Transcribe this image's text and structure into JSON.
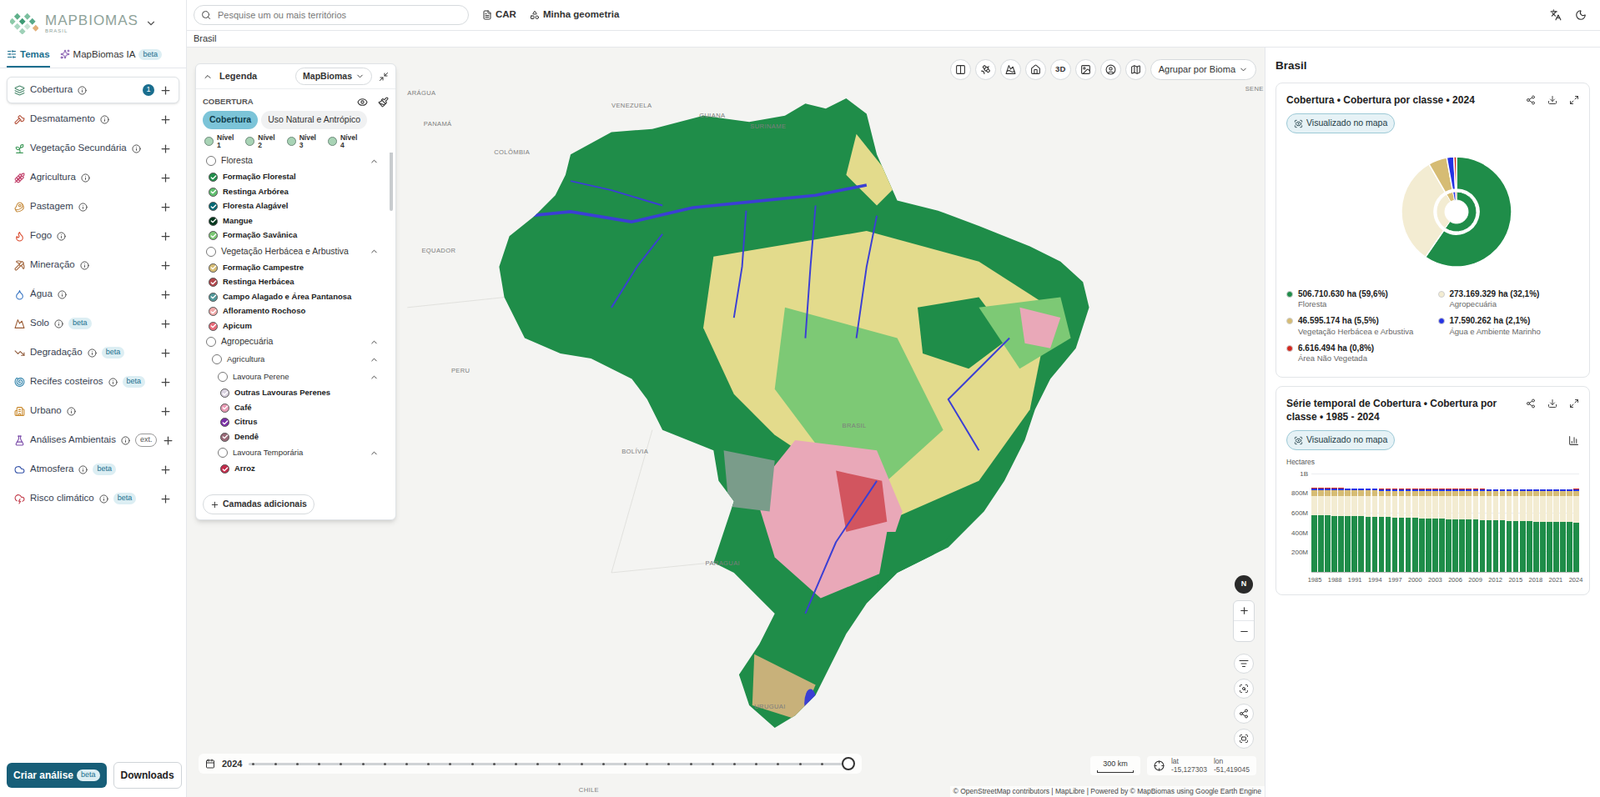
{
  "logo": {
    "name": "MAPBIOMAS",
    "subtitle": "BRASIL"
  },
  "sidebar_tabs": [
    {
      "label": "Temas",
      "selected": true
    },
    {
      "label": "MapBiomas IA",
      "badge": "beta",
      "selected": false
    }
  ],
  "themes": [
    {
      "label": "Cobertura",
      "count": "1",
      "selected": true,
      "color": "#4b8a6e"
    },
    {
      "label": "Desmatamento",
      "selected": false,
      "color": "#b5533c"
    },
    {
      "label": "Vegetação Secundária",
      "selected": false,
      "color": "#3f9a5a"
    },
    {
      "label": "Agricultura",
      "selected": false,
      "color": "#c2416b"
    },
    {
      "label": "Pastagem",
      "selected": false,
      "color": "#c58b3d"
    },
    {
      "label": "Fogo",
      "selected": false,
      "color": "#d9482b"
    },
    {
      "label": "Mineração",
      "selected": false,
      "color": "#a0633a"
    },
    {
      "label": "Água",
      "selected": false,
      "color": "#2f6fc0"
    },
    {
      "label": "Solo",
      "badge": "beta",
      "badge_kind": "filled",
      "selected": false,
      "color": "#9a5b34"
    },
    {
      "label": "Degradação",
      "badge": "beta",
      "badge_kind": "filled",
      "selected": false,
      "color": "#8f5a3a"
    },
    {
      "label": "Recifes costeiros",
      "badge": "beta",
      "badge_kind": "filled",
      "selected": false,
      "color": "#2a7fa8"
    },
    {
      "label": "Urbano",
      "selected": false,
      "color": "#c98a2e"
    },
    {
      "label": "Análises Ambientais",
      "badge": "ext.",
      "badge_kind": "outline",
      "selected": false,
      "color": "#7a4aa8"
    },
    {
      "label": "Atmosfera",
      "badge": "beta",
      "badge_kind": "filled",
      "selected": false,
      "color": "#3553a8"
    },
    {
      "label": "Risco climático",
      "badge": "beta",
      "badge_kind": "filled",
      "selected": false,
      "color": "#c23b4a"
    }
  ],
  "sidebar_buttons": {
    "primary": {
      "label": "Criar análise",
      "badge": "beta"
    },
    "secondary": "Downloads"
  },
  "search": {
    "placeholder": "Pesquise um ou mais territórios"
  },
  "top_links": [
    "CAR",
    "Minha geometria"
  ],
  "breadcrumb": "Brasil",
  "legend": {
    "title": "Legenda",
    "expanded": true,
    "source": "MapBiomas",
    "section": "COBERTURA",
    "modes": [
      {
        "label": "Cobertura",
        "selected": true
      },
      {
        "label": "Uso Natural e Antrópico",
        "selected": false
      }
    ],
    "levels": [
      {
        "label": "Nível",
        "number": "1",
        "selected": false
      },
      {
        "label": "Nível",
        "number": "2",
        "selected": false
      },
      {
        "label": "Nível",
        "number": "3",
        "selected": false
      },
      {
        "label": "Nível",
        "number": "4",
        "selected": false
      }
    ],
    "items": [
      {
        "kind": "group",
        "label": "Floresta",
        "depth": 0,
        "expanded": true,
        "checked": false
      },
      {
        "kind": "class",
        "label": "Formação Florestal",
        "depth": 1,
        "checked": true,
        "color": "#1f8d49"
      },
      {
        "kind": "class",
        "label": "Restinga Arbórea",
        "depth": 1,
        "checked": true,
        "color": "#5fbf6e"
      },
      {
        "kind": "class",
        "label": "Floresta Alagável",
        "depth": 1,
        "checked": true,
        "color": "#026975"
      },
      {
        "kind": "class",
        "label": "Mangue",
        "depth": 1,
        "checked": true,
        "color": "#04381d"
      },
      {
        "kind": "class",
        "label": "Formação Savânica",
        "depth": 1,
        "checked": true,
        "color": "#7dc975"
      },
      {
        "kind": "group",
        "label": "Vegetação Herbácea e Arbustiva",
        "depth": 0,
        "expanded": true,
        "checked": false
      },
      {
        "kind": "class",
        "label": "Formação Campestre",
        "depth": 1,
        "checked": true,
        "color": "#d6bc74"
      },
      {
        "kind": "class",
        "label": "Restinga Herbácea",
        "depth": 1,
        "checked": true,
        "color": "#b2464b"
      },
      {
        "kind": "class",
        "label": "Campo Alagado e Área Pantanosa",
        "depth": 1,
        "checked": true,
        "color": "#519799"
      },
      {
        "kind": "class",
        "label": "Afloramento Rochoso",
        "depth": 1,
        "checked": true,
        "color": "#f0a8a8"
      },
      {
        "kind": "class",
        "label": "Apicum",
        "depth": 1,
        "checked": true,
        "color": "#e86b7a"
      },
      {
        "kind": "group",
        "label": "Agropecuária",
        "depth": 0,
        "expanded": true,
        "checked": false
      },
      {
        "kind": "group",
        "label": "Agricultura",
        "depth": 1,
        "expanded": true,
        "checked": false
      },
      {
        "kind": "group",
        "label": "Lavoura Perene",
        "depth": 2,
        "expanded": true,
        "checked": false
      },
      {
        "kind": "class",
        "label": "Outras Lavouras Perenes",
        "depth": 3,
        "checked": true,
        "color": "#d9d2e0"
      },
      {
        "kind": "class",
        "label": "Café",
        "depth": 3,
        "checked": true,
        "color": "#e89ab4"
      },
      {
        "kind": "class",
        "label": "Citrus",
        "depth": 3,
        "checked": true,
        "color": "#7b2fa8"
      },
      {
        "kind": "class",
        "label": "Dendê",
        "depth": 3,
        "checked": true,
        "color": "#9a6a78"
      },
      {
        "kind": "group",
        "label": "Lavoura Temporária",
        "depth": 2,
        "expanded": true,
        "checked": false
      },
      {
        "kind": "class",
        "label": "Arroz",
        "depth": 3,
        "checked": true,
        "color": "#c22a4a"
      }
    ],
    "footer_button": "Camadas adicionais"
  },
  "map": {
    "toolbar_text": "3D",
    "group_by": "Agrupar por Bioma",
    "labels": [
      "ARÁGUA",
      "VENEZUELA",
      "GUIANA",
      "SURINAME",
      "PANAMÁ",
      "COLÔMBIA",
      "EQUADOR",
      "PERU",
      "BOLÍVIA",
      "PARAGUAI",
      "URUGUAI",
      "CHILE",
      "BRASIL",
      "SENE"
    ],
    "compass": "N",
    "timeline": {
      "year": "2024",
      "level": 1
    },
    "scale": "300 km",
    "coords": {
      "lat_label": "lat",
      "lat": "-15,127303",
      "lon_label": "lon",
      "lon": "-51,419045"
    },
    "attribution": "© OpenStreetMap contributors | MapLibre | Powered by © MapBiomas using Google Earth Engine"
  },
  "panel": {
    "title": "Brasil",
    "pie_card": {
      "title": "Cobertura • Cobertura por classe • 2024",
      "chip": "Visualizado no mapa",
      "items": [
        {
          "label": "Floresta",
          "value": 506710630,
          "text": "506.710.630 ha (59,6%)",
          "color": "#1f8d49"
        },
        {
          "label": "Agropecuária",
          "value": 273169329,
          "text": "273.169.329 ha (32,1%)",
          "color": "#f3ecd2"
        },
        {
          "label": "Vegetação Herbácea e Arbustiva",
          "value": 46595174,
          "text": "46.595.174 ha (5,5%)",
          "color": "#d6bc74"
        },
        {
          "label": "Água e Ambiente Marinho",
          "value": 17590262,
          "text": "17.590.262 ha (2,1%)",
          "color": "#2532e4"
        },
        {
          "label": "Área Não Vegetada",
          "value": 6616494,
          "text": "6.616.494 ha (0,8%)",
          "color": "#d4271e"
        }
      ]
    },
    "series_card": {
      "title": "Série temporal de Cobertura • Cobertura por classe • 1985 - 2024",
      "chip": "Visualizado no mapa",
      "y_label": "Hectares",
      "y_max": 1000,
      "y_ticks": [
        {
          "label": "1B",
          "value": 1000
        },
        {
          "label": "800M",
          "value": 800
        },
        {
          "label": "600M",
          "value": 600
        },
        {
          "label": "400M",
          "value": 400
        },
        {
          "label": "200M",
          "value": 200
        }
      ],
      "x_labels": [
        {
          "label": "1985",
          "index": 0
        },
        {
          "label": "1988",
          "index": 3
        },
        {
          "label": "1991",
          "index": 6
        },
        {
          "label": "1994",
          "index": 9
        },
        {
          "label": "1997",
          "index": 12
        },
        {
          "label": "2000",
          "index": 15
        },
        {
          "label": "2003",
          "index": 18
        },
        {
          "label": "2006",
          "index": 21
        },
        {
          "label": "2009",
          "index": 24
        },
        {
          "label": "2012",
          "index": 27
        },
        {
          "label": "2015",
          "index": 30
        },
        {
          "label": "2018",
          "index": 33
        },
        {
          "label": "2021",
          "index": 36
        },
        {
          "label": "2024",
          "index": 39
        }
      ],
      "series": [
        {
          "name": "Floresta",
          "color": "#1f8d49",
          "values": [
            581,
            579,
            577,
            575,
            573,
            571,
            569,
            567,
            565,
            563,
            561,
            559,
            557,
            555,
            553,
            551,
            549,
            547,
            545,
            543,
            541,
            539,
            537,
            535,
            533,
            531,
            529,
            527,
            525,
            523,
            521,
            519,
            517,
            515,
            513,
            512,
            511,
            510,
            508,
            507
          ]
        },
        {
          "name": "Agropecuária",
          "color": "#f3ecd2",
          "values": [
            195,
            197,
            199,
            201,
            203,
            205,
            207,
            209,
            211,
            213,
            215,
            217,
            219,
            221,
            223,
            225,
            227,
            229,
            231,
            233,
            235,
            237,
            239,
            241,
            243,
            245,
            247,
            249,
            251,
            253,
            255,
            257,
            259,
            261,
            263,
            265,
            267,
            269,
            271,
            273
          ]
        },
        {
          "name": "Vegetação Herbácea e Arbustiva",
          "color": "#d6bc74",
          "values": [
            60,
            60,
            59,
            59,
            59,
            58,
            58,
            58,
            57,
            57,
            56,
            56,
            56,
            55,
            55,
            55,
            54,
            54,
            53,
            53,
            53,
            52,
            52,
            52,
            51,
            51,
            50,
            50,
            50,
            49,
            49,
            49,
            48,
            48,
            48,
            47,
            47,
            47,
            47,
            47
          ]
        },
        {
          "name": "Água e Ambiente Marinho",
          "color": "#2532e4",
          "values": [
            18,
            18,
            18,
            18,
            18,
            18,
            18,
            18,
            18,
            18,
            17,
            17,
            17,
            17,
            17,
            17,
            17,
            17,
            17,
            17,
            17,
            17,
            17,
            17,
            17,
            17,
            17,
            17,
            17,
            17,
            17,
            17,
            17,
            17,
            17,
            17,
            17,
            17,
            17,
            17
          ]
        },
        {
          "name": "Área Não Vegetada",
          "color": "#d4271e",
          "values": [
            5,
            5,
            5,
            5,
            5,
            5,
            5,
            5,
            5,
            5,
            5,
            5,
            5,
            5,
            5,
            5,
            5,
            5,
            5,
            5,
            6,
            6,
            6,
            6,
            6,
            6,
            6,
            6,
            6,
            6,
            6,
            6,
            6,
            6,
            6,
            6,
            6,
            6,
            6,
            7
          ]
        }
      ]
    }
  }
}
